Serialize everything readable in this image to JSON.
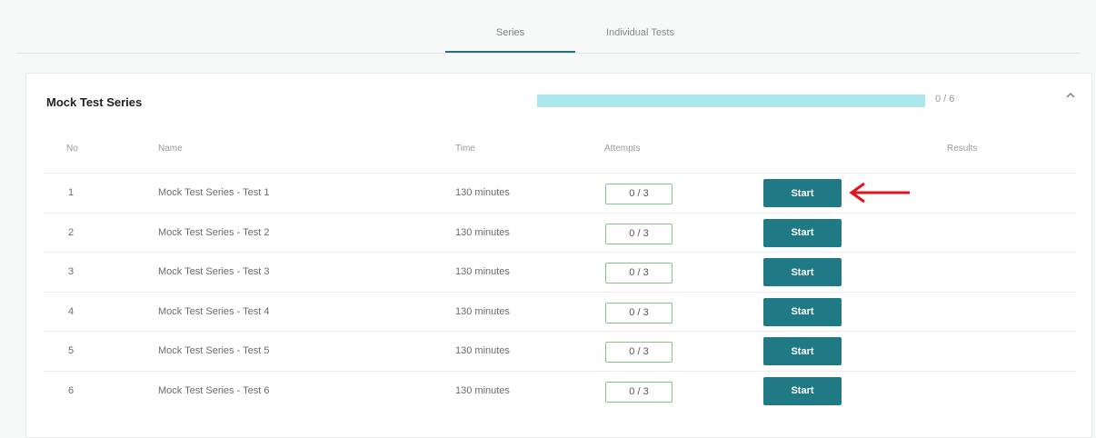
{
  "tabs": [
    {
      "label": "Series",
      "active": true
    },
    {
      "label": "Individual Tests",
      "active": false
    }
  ],
  "series": {
    "title": "Mock Test Series",
    "progress_text": "0 / 6",
    "progress_fraction": 0,
    "collapse_icon": "chevron-up-icon"
  },
  "table": {
    "headers": {
      "no": "No",
      "name": "Name",
      "time": "Time",
      "attempts": "Attempts",
      "results": "Results"
    },
    "rows": [
      {
        "no": "1",
        "name": "Mock Test Series - Test 1",
        "time": "130 minutes",
        "attempts": "0 / 3",
        "action": "Start"
      },
      {
        "no": "2",
        "name": "Mock Test Series - Test 2",
        "time": "130 minutes",
        "attempts": "0 / 3",
        "action": "Start"
      },
      {
        "no": "3",
        "name": "Mock Test Series - Test 3",
        "time": "130 minutes",
        "attempts": "0 / 3",
        "action": "Start"
      },
      {
        "no": "4",
        "name": "Mock Test Series - Test 4",
        "time": "130 minutes",
        "attempts": "0 / 3",
        "action": "Start"
      },
      {
        "no": "5",
        "name": "Mock Test Series - Test 5",
        "time": "130 minutes",
        "attempts": "0 / 3",
        "action": "Start"
      },
      {
        "no": "6",
        "name": "Mock Test Series - Test 6",
        "time": "130 minutes",
        "attempts": "0 / 3",
        "action": "Start"
      }
    ]
  },
  "colors": {
    "accent": "#21717f",
    "start_button": "#1f7a86",
    "progress_track": "#aee6ee",
    "attempts_border": "#7fc58c",
    "annotation_arrow": "#e3121b"
  },
  "annotation": {
    "icon": "red-arrow-icon"
  }
}
